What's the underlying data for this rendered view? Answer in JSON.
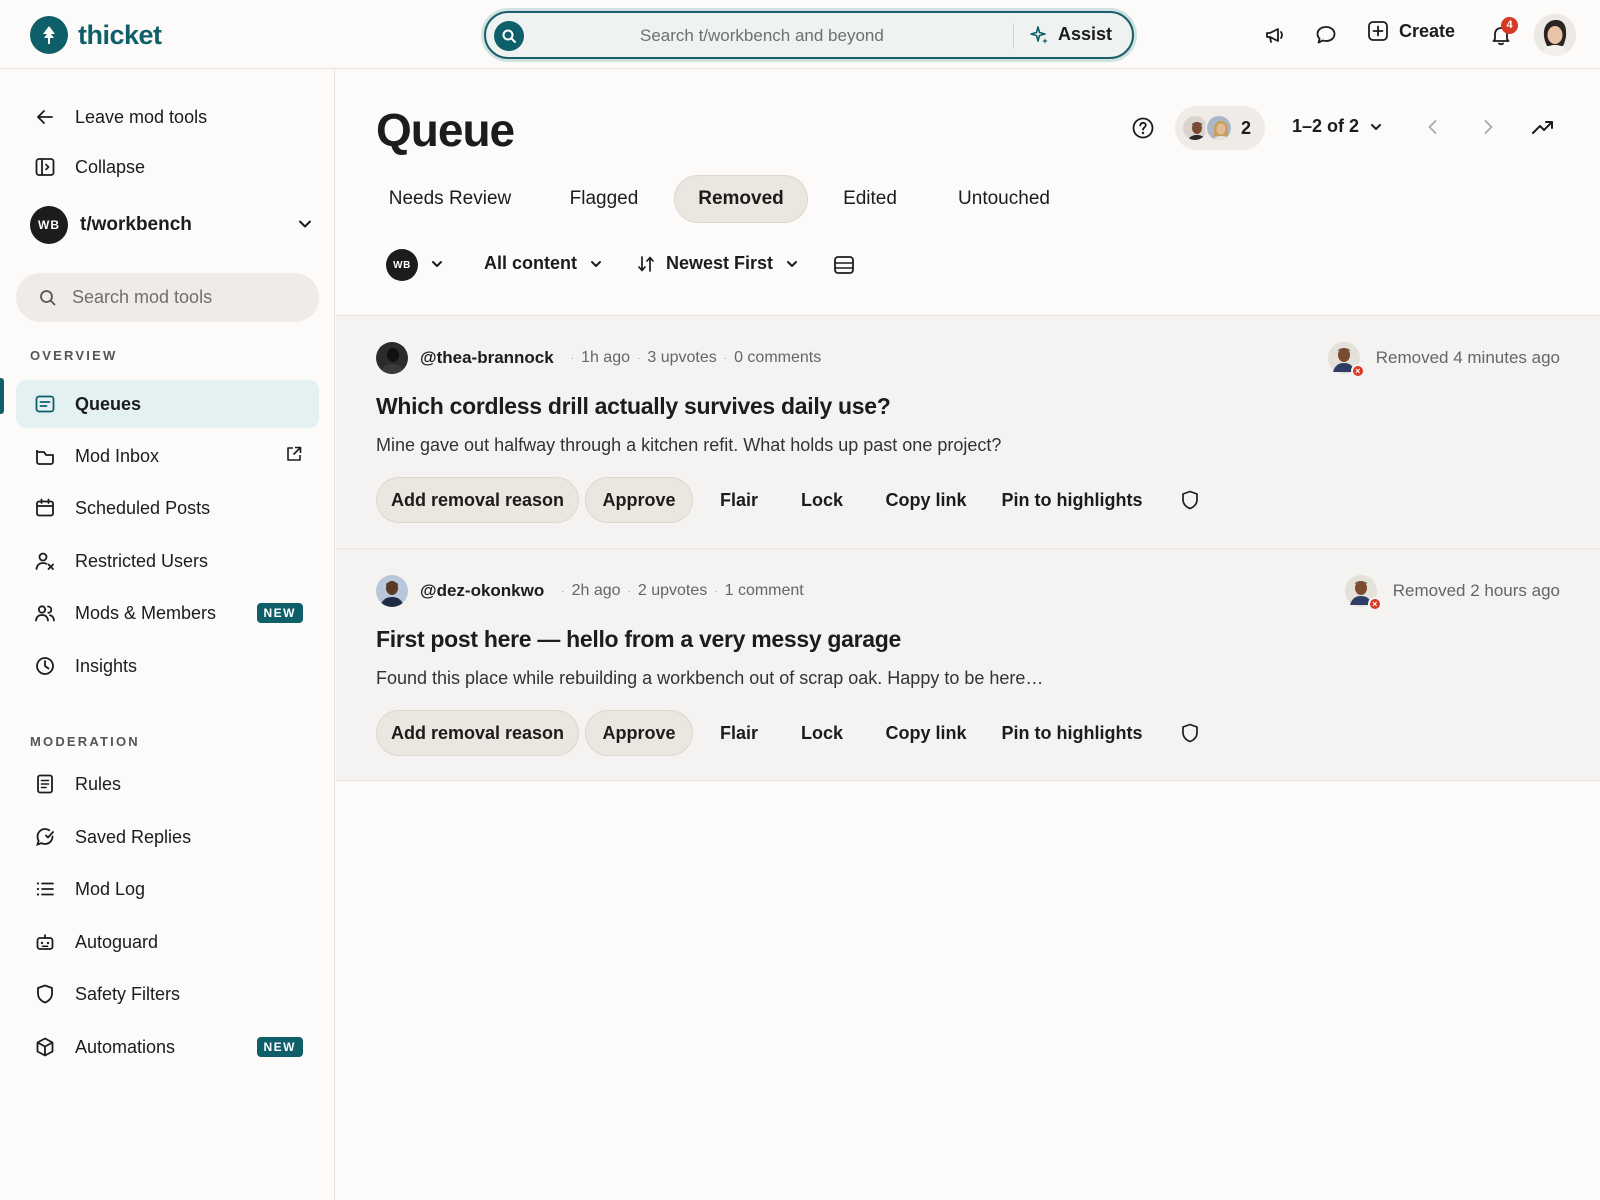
{
  "app": {
    "name": "thicket"
  },
  "header": {
    "search_placeholder": "Search t/workbench and beyond",
    "assist_label": "Assist",
    "create_label": "Create",
    "notification_count": "4"
  },
  "sidebar": {
    "leave_label": "Leave mod tools",
    "collapse_label": "Collapse",
    "community": {
      "badge": "WB",
      "name": "t/workbench"
    },
    "search_placeholder": "Search mod tools",
    "overview_title": "OVERVIEW",
    "overview_items": [
      {
        "label": "Queues",
        "icon": "queue-icon",
        "active": true
      },
      {
        "label": "Mod Inbox",
        "icon": "inbox-icon"
      },
      {
        "label": "Scheduled Posts",
        "icon": "calendar-icon"
      },
      {
        "label": "Restricted Users",
        "icon": "restricted-user-icon"
      },
      {
        "label": "Mods & Members",
        "icon": "members-icon",
        "badge": "NEW"
      },
      {
        "label": "Insights",
        "icon": "clock-icon"
      }
    ],
    "moderation_title": "MODERATION",
    "moderation_items": [
      {
        "label": "Rules",
        "icon": "rules-icon"
      },
      {
        "label": "Saved Replies",
        "icon": "saved-replies-icon"
      },
      {
        "label": "Mod Log",
        "icon": "list-icon"
      },
      {
        "label": "Autoguard",
        "icon": "robot-icon"
      },
      {
        "label": "Safety Filters",
        "icon": "shield-icon"
      },
      {
        "label": "Automations",
        "icon": "cube-icon",
        "badge": "NEW"
      }
    ]
  },
  "main": {
    "title": "Queue",
    "mod_count": "2",
    "paging": "1–2 of 2",
    "tabs": [
      {
        "label": "Needs Review"
      },
      {
        "label": "Flagged"
      },
      {
        "label": "Removed",
        "selected": true
      },
      {
        "label": "Edited"
      },
      {
        "label": "Untouched"
      }
    ],
    "filters": {
      "community_badge": "WB",
      "content": "All content",
      "sort": "Newest First"
    },
    "posts": [
      {
        "username": "@thea-brannock",
        "time": "1h ago",
        "upvotes": "3 upvotes",
        "comments": "0 comments",
        "removed": "Removed 4 minutes ago",
        "title": "Which cordless drill actually survives daily use?",
        "body": "Mine gave out halfway through a kitchen refit. What holds up past one project?"
      },
      {
        "username": "@dez-okonkwo",
        "time": "2h ago",
        "upvotes": "2 upvotes",
        "comments": "1 comment",
        "removed": "Removed 2 hours ago",
        "title": "First post here — hello from a very messy garage",
        "body": "Found this place while rebuilding a workbench out of scrap oak. Happy to be here…"
      }
    ],
    "actions": {
      "add_reason": "Add removal reason",
      "approve": "Approve",
      "flair": "Flair",
      "lock": "Lock",
      "copy_link": "Copy link",
      "pin": "Pin to highlights"
    }
  },
  "colors": {
    "brand": "#0f5f6b",
    "alert": "#d63a24",
    "selected_tab": "#ebe6df"
  }
}
